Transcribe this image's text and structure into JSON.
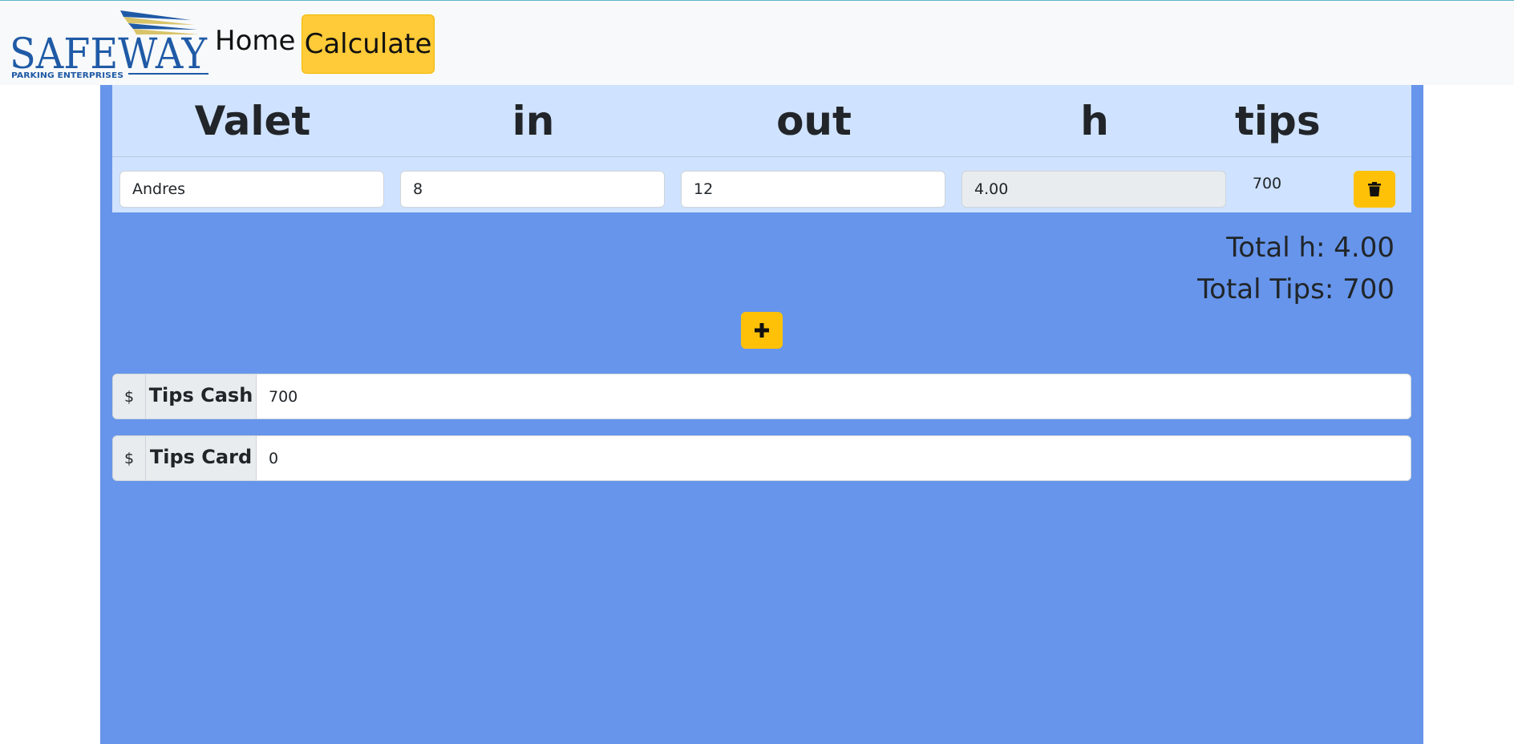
{
  "nav": {
    "logo_text": "SAFEWAY",
    "logo_subtext": "PARKING ENTERPRISES",
    "home_label": "Home",
    "calculate_label": "Calculate"
  },
  "table": {
    "headers": [
      "Valet",
      "in",
      "out",
      "h",
      "tips"
    ],
    "rows": [
      {
        "valet": "Andres",
        "in": "8",
        "out": "12",
        "h": "4.00",
        "tips": "700"
      }
    ]
  },
  "totals": {
    "hours_text": "Total h: 4.00",
    "tips_text": "Total Tips: 700"
  },
  "tips_cash": {
    "currency": "$",
    "label": "Tips Cash",
    "value": "700"
  },
  "tips_card": {
    "currency": "$",
    "label": "Tips Card",
    "value": "0"
  },
  "colors": {
    "panel": "#6695eb",
    "table_bg": "#cfe2ff",
    "accent_yellow": "#ffc107",
    "logo_blue": "#1f5aa6"
  },
  "icons": {
    "delete": "trash-icon",
    "add": "plus-icon"
  }
}
